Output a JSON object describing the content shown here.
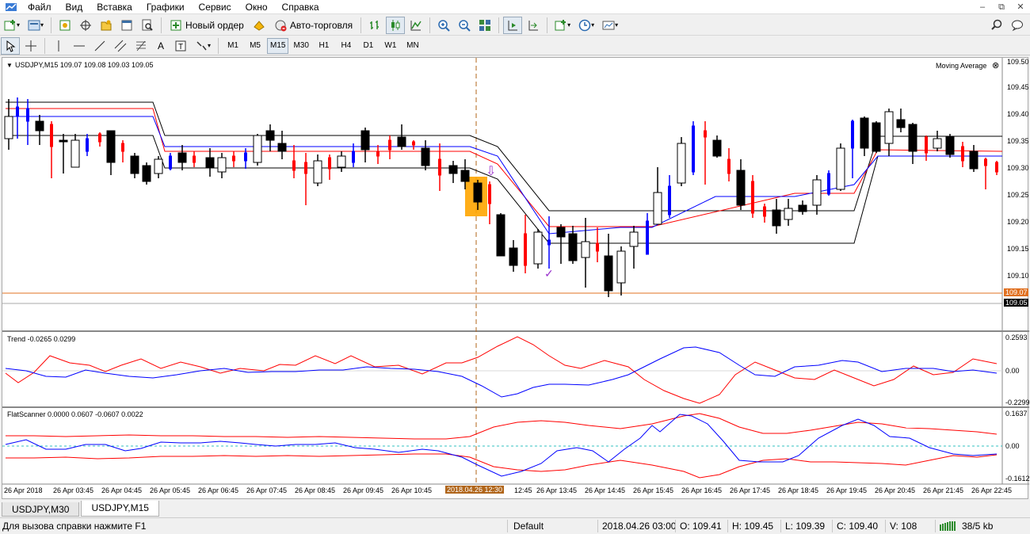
{
  "menu": [
    "Файл",
    "Вид",
    "Вставка",
    "Графики",
    "Сервис",
    "Окно",
    "Справка"
  ],
  "toolbar": {
    "new_order": "Новый ордер",
    "auto_trading": "Авто-торговля"
  },
  "timeframes": [
    "M1",
    "M5",
    "M15",
    "M30",
    "H1",
    "H4",
    "D1",
    "W1",
    "MN"
  ],
  "active_timeframe": "M15",
  "chart": {
    "symbol_info": "USDJPY,M15  109.07 109.08 109.03 109.05",
    "indicator_label": "Moving Average",
    "price_labels": [
      "109.50",
      "109.45",
      "109.40",
      "109.35",
      "109.30",
      "109.25",
      "109.20",
      "109.15",
      "109.10"
    ],
    "bid_label": "109.07",
    "ask_label": "109.05",
    "current_time_label": "2018.04.26 12:30",
    "time_labels": [
      "26 Apr 2018",
      "26 Apr 03:45",
      "26 Apr 04:45",
      "26 Apr 05:45",
      "26 Apr 06:45",
      "26 Apr 07:45",
      "26 Apr 08:45",
      "26 Apr 09:45",
      "26 Apr 10:45",
      "12:45",
      "26 Apr 13:45",
      "26 Apr 14:45",
      "26 Apr 15:45",
      "26 Apr 16:45",
      "26 Apr 17:45",
      "26 Apr 18:45",
      "26 Apr 19:45",
      "26 Apr 20:45",
      "26 Apr 21:45",
      "26 Apr 22:45"
    ],
    "colors": {
      "bull": "#0000ff",
      "bear": "#ff0000",
      "band_red": "#ff0000",
      "band_blue": "#0000ff",
      "highlight": "#ffa500"
    }
  },
  "trend_panel": {
    "label": "Trend -0.0265 0.0299",
    "scale": [
      "0.2593",
      "0.00",
      "-0.2299"
    ]
  },
  "flat_panel": {
    "label": "FlatScanner 0.0000 0.0607 -0.0607 0.0022",
    "scale": [
      "0.1637",
      "0.00",
      "-0.1612"
    ]
  },
  "tabs": [
    "USDJPY,M30",
    "USDJPY,M15"
  ],
  "active_tab": "USDJPY,M15",
  "status": {
    "help": "Для вызова справки нажмите F1",
    "profile": "Default",
    "datetime": "2018.04.26 03:00",
    "open": "O: 109.41",
    "high": "H: 109.45",
    "low": "L: 109.39",
    "close": "C: 109.40",
    "volume": "V: 108",
    "traffic": "38/5 kb"
  }
}
